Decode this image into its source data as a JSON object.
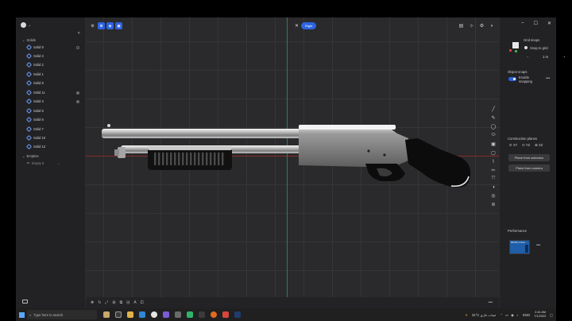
{
  "outliner": {
    "section_solids": "Solids",
    "items": [
      "Solid 9",
      "Solid 3",
      "Solid 2",
      "Solid 1",
      "Solid 8",
      "Solid 11",
      "Solid 4",
      "Solid 5",
      "Solid 6",
      "Solid 7",
      "Solid 10",
      "Solid 12"
    ],
    "section_empties": "Empties",
    "empty_item": "Empty 6"
  },
  "viewport": {
    "view_pill": "Right"
  },
  "right_panel": {
    "grid_snaps_label": "Grid snaps",
    "snap_to_grid": "Snap to grid",
    "grid_size": "1 m",
    "object_snaps_label": "Object snaps",
    "enable_snapping": "Enable snapping",
    "construction_planes_label": "Construction planes",
    "plane_xy": "XY",
    "plane_yz": "YZ",
    "plane_xz": "XZ",
    "plane_from_selection": "Plane from selection",
    "plane_from_camera": "Plane from camera",
    "performance_label": "Performance",
    "perf_readout": "58 FPS | 0.6ms"
  },
  "taskbar": {
    "search_placeholder": "Type here to search",
    "weather": "31°C ضباب غازي",
    "language": "ENG",
    "time": "2:44 AM",
    "date": "7/1/2023"
  },
  "colors": {
    "accent": "#2d63e0",
    "axis_x": "#8a2b2b",
    "axis_y": "#2a7b6f"
  }
}
